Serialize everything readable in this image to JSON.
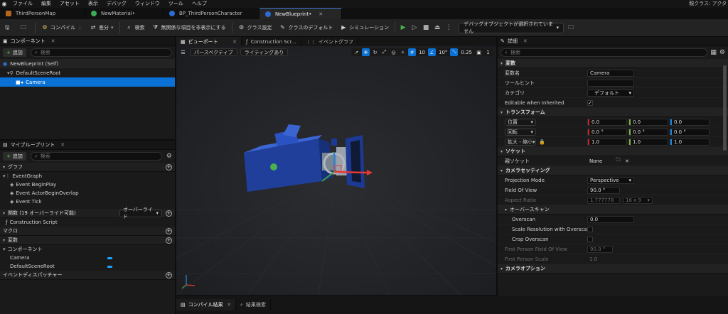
{
  "menu": {
    "items": [
      "ファイル",
      "編集",
      "アセット",
      "表示",
      "デバッグ",
      "ウィンドウ",
      "ツール",
      "ヘルプ"
    ],
    "right_text": "親クラス: アクタ"
  },
  "tabs": [
    {
      "label": "ThirdPersonMap",
      "color": "#b5651d"
    },
    {
      "label": "NewMaterial•",
      "color": "#3aaa55"
    },
    {
      "label": "BP_ThirdPersonCharacter",
      "color": "#2d6bd1"
    },
    {
      "label": "NewBlueprint•",
      "color": "#2d6bd1",
      "active": true
    }
  ],
  "toolbar": {
    "compile": "コンパイル",
    "diff": "差分",
    "search": "検索",
    "hide_unrelated": "無関係な項目を非表示にする",
    "class_settings": "クラス設定",
    "class_defaults": "クラスのデフォルト",
    "simulation": "シミュレーション",
    "debug_object": "デバッグオブジェクトが選択されていません"
  },
  "components": {
    "title": "コンポーネント",
    "add": "追加",
    "search_placeholder": "検索",
    "tree": [
      {
        "label": "NewBlueprint (Self)",
        "indent": 0
      },
      {
        "label": "DefaultSceneRoot",
        "indent": 1
      },
      {
        "label": "Camera",
        "indent": 2,
        "selected": true
      }
    ]
  },
  "my_blueprint": {
    "title": "マイブループリント",
    "add": "追加",
    "search_placeholder": "検索",
    "graph_section": "グラフ",
    "event_graph": "EventGraph",
    "events": [
      "Event BeginPlay",
      "Event ActorBeginOverlap",
      "Event Tick"
    ],
    "functions_section": "関数 (19 オーバーライド可能)",
    "override_label": "オーバーライド",
    "construction_script": "Construction Script",
    "macros_section": "マクロ",
    "variables_section": "変数",
    "components_sub": "コンポーネント",
    "variables": [
      "Camera",
      "DefaultSceneRoot"
    ],
    "dispatchers_section": "イベントディスパッチャー"
  },
  "viewport": {
    "tabs": [
      "ビューポート",
      "Construction Scr...",
      "イベントグラフ"
    ],
    "perspective": "パースペクティブ",
    "lighting": "ライティングあり",
    "grid_snap": "10",
    "rot_snap": "10°",
    "scale_snap": "0.25",
    "cam_speed": "1"
  },
  "bottom": {
    "compile_results": "コンパイル結果",
    "find_results": "結果検索"
  },
  "details": {
    "title": "詳細",
    "search_placeholder": "検索",
    "variable_section": "変数",
    "var_name_label": "変数名",
    "var_name_value": "Camera",
    "tooltip_label": "ツールヒント",
    "category_label": "カテゴリ",
    "category_value": "デフォルト",
    "editable_label": "Editable when Inherited",
    "transform_section": "トランスフォーム",
    "location_label": "位置",
    "rotation_label": "回転",
    "scale_label": "拡大・縮小",
    "location": [
      "0.0",
      "0.0",
      "0.0"
    ],
    "rotation": [
      "0.0 °",
      "0.0 °",
      "0.0 °"
    ],
    "scale": [
      "1.0",
      "1.0",
      "1.0"
    ],
    "socket_section": "ソケット",
    "parent_socket_label": "親ソケット",
    "parent_socket_value": "None",
    "camera_settings_section": "カメラセッティング",
    "projection_label": "Projection Mode",
    "projection_value": "Perspective",
    "fov_label": "Field Of View",
    "fov_value": "90.0 °",
    "aspect_label": "Aspect Ratio",
    "aspect_value": "1.777778",
    "aspect_preset": "16 x 9",
    "overscan_section": "オーバースキャン",
    "overscan_label": "Overscan",
    "overscan_value": "0.0",
    "scale_res_label": "Scale Resolution with Overscan",
    "crop_label": "Crop Overscan",
    "fp_fov_label": "First Person Field Of View",
    "fp_fov_value": "90.0 °",
    "fp_scale_label": "First Person Scale",
    "fp_scale_value": "1.0",
    "camera_options_section": "カメラオプション"
  }
}
